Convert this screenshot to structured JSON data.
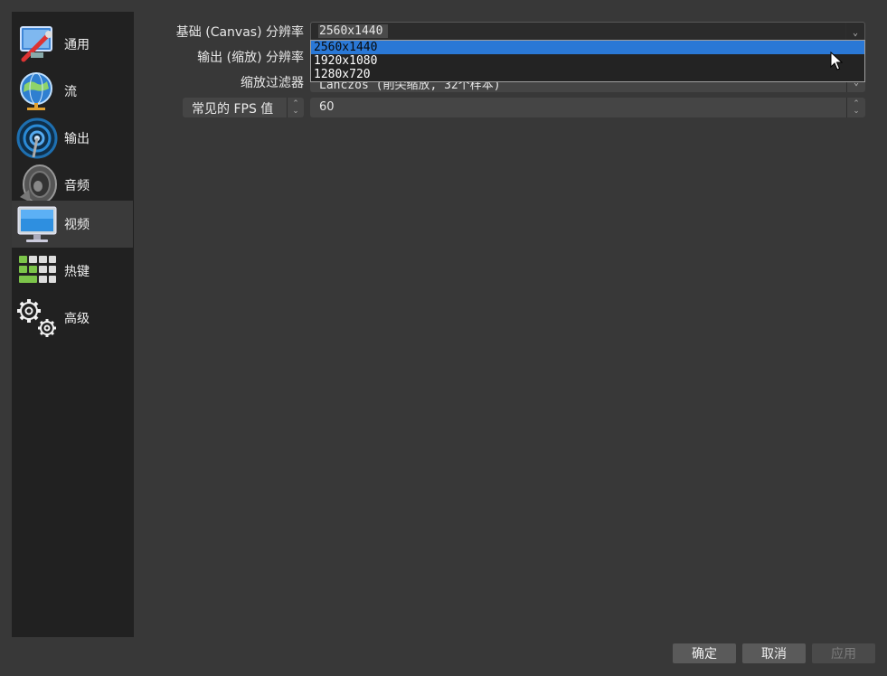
{
  "sidebar": {
    "items": [
      {
        "label": "通用",
        "icon": "general-settings-icon"
      },
      {
        "label": "流",
        "icon": "stream-globe-icon"
      },
      {
        "label": "输出",
        "icon": "output-broadcast-icon"
      },
      {
        "label": "音频",
        "icon": "audio-speaker-icon"
      },
      {
        "label": "视频",
        "icon": "video-monitor-icon",
        "active": true
      },
      {
        "label": "热键",
        "icon": "hotkeys-keyboard-icon"
      },
      {
        "label": "高级",
        "icon": "advanced-gears-icon"
      }
    ]
  },
  "video": {
    "base_resolution": {
      "label": "基础 (Canvas) 分辨率",
      "value": "2560x1440",
      "options": [
        "2560x1440",
        "1920x1080",
        "1280x720"
      ],
      "open": true
    },
    "output_resolution": {
      "label": "输出 (缩放) 分辨率"
    },
    "downscale_filter": {
      "label": "缩放过滤器",
      "value": "Lanczos (削尖缩放, 32个样本)"
    },
    "fps": {
      "type_value": "常见的 FPS 值",
      "value": "60"
    }
  },
  "buttons": {
    "ok": "确定",
    "cancel": "取消",
    "apply": "应用"
  },
  "colors": {
    "background": "#383838",
    "sidebar": "#212121",
    "selection": "#2a78d6"
  }
}
